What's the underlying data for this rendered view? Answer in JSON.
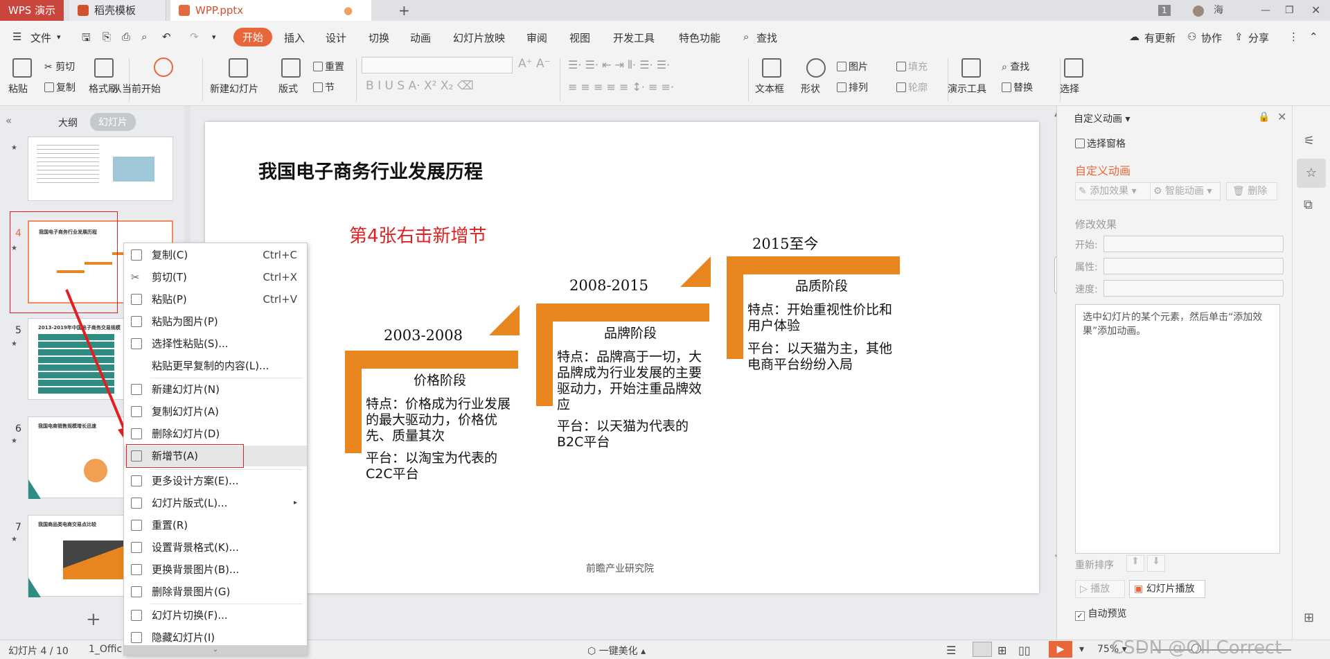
{
  "titlebar": {
    "app": "WPS 演示",
    "tab1": "稻壳模板",
    "tab2": "WPP.pptx",
    "new_tab": "+",
    "badge": "1",
    "user": "海"
  },
  "menu": {
    "file": "文件",
    "items": [
      "开始",
      "插入",
      "设计",
      "切换",
      "动画",
      "幻灯片放映",
      "审阅",
      "视图",
      "开发工具",
      "特色功能"
    ],
    "search": "查找",
    "update": "有更新",
    "collab": "协作",
    "share": "分享"
  },
  "ribbon": {
    "paste": "粘贴",
    "cut": "剪切",
    "copy": "复制",
    "format_painter": "格式刷",
    "from_current": "从当前开始",
    "new_slide": "新建幻灯片",
    "layout": "版式",
    "reset": "重置",
    "section": "节",
    "textbox": "文本框",
    "shape": "形状",
    "picture": "图片",
    "fill": "填充",
    "arrange": "排列",
    "outline": "轮廓",
    "present_tools": "演示工具",
    "find": "查找",
    "replace": "替换",
    "select": "选择"
  },
  "leftpanel": {
    "tab_outline": "大纲",
    "tab_slides": "幻灯片",
    "slide_numbers": [
      "4",
      "5",
      "6",
      "7"
    ],
    "add": "+",
    "thumb_titles": [
      "我国电子商务行业发展历程",
      "2013-2019年中国电子商务交易规模",
      "我国电商销售规模增长迅速",
      "我国商品类电商交易点比较"
    ]
  },
  "slide": {
    "title": "我国电子商务行业发展历程",
    "annotation": "第4张右击新增节",
    "footer": "前瞻产业研究院",
    "stages": [
      {
        "year": "2003-2008",
        "name": "价格阶段",
        "feature": "特点：价格成为行业发展的最大驱动力，价格优先、质量其次",
        "platform": "平台：以淘宝为代表的C2C平台"
      },
      {
        "year": "2008-2015",
        "name": "品牌阶段",
        "feature": "特点：品牌高于一切，大品牌成为行业发展的主要驱动力，开始注重品牌效应",
        "platform": "平台：以天猫为代表的B2C平台"
      },
      {
        "year": "2015至今",
        "name": "品质阶段",
        "feature": "特点：开始重视性价比和用户体验",
        "platform": "平台：以天猫为主，其他电商平台纷纷入局"
      }
    ]
  },
  "contextmenu": [
    {
      "label": "复制(C)",
      "shortcut": "Ctrl+C"
    },
    {
      "label": "剪切(T)",
      "shortcut": "Ctrl+X"
    },
    {
      "label": "粘贴(P)",
      "shortcut": "Ctrl+V"
    },
    {
      "label": "粘贴为图片(P)",
      "shortcut": ""
    },
    {
      "label": "选择性粘贴(S)...",
      "shortcut": ""
    },
    {
      "label": "粘贴更早复制的内容(L)...",
      "shortcut": ""
    },
    {
      "label": "新建幻灯片(N)",
      "shortcut": ""
    },
    {
      "label": "复制幻灯片(A)",
      "shortcut": ""
    },
    {
      "label": "删除幻灯片(D)",
      "shortcut": ""
    },
    {
      "label": "新增节(A)",
      "shortcut": ""
    },
    {
      "label": "更多设计方案(E)...",
      "shortcut": ""
    },
    {
      "label": "幻灯片版式(L)...",
      "shortcut": ""
    },
    {
      "label": "重置(R)",
      "shortcut": ""
    },
    {
      "label": "设置背景格式(K)...",
      "shortcut": ""
    },
    {
      "label": "更换背景图片(B)...",
      "shortcut": ""
    },
    {
      "label": "删除背景图片(G)",
      "shortcut": ""
    },
    {
      "label": "幻灯片切换(F)...",
      "shortcut": ""
    },
    {
      "label": "隐藏幻灯片(I)",
      "shortcut": ""
    }
  ],
  "rightpanel": {
    "header": "自定义动画",
    "select_pane": "选择窗格",
    "section_title": "自定义动画",
    "add_effect": "添加效果",
    "smart_anim": "智能动画",
    "delete": "删除",
    "modify": "修改效果",
    "start": "开始:",
    "property": "属性:",
    "speed": "速度:",
    "hint": "选中幻灯片的某个元素，然后单击“添加效果”添加动画。",
    "reorder": "重新排序",
    "play": "播放",
    "slideshow": "幻灯片播放",
    "autopreview": "自动预览"
  },
  "statusbar": {
    "slide_info": "幻灯片 4 / 10",
    "theme": "1_Offic",
    "beautify": "一键美化",
    "zoom": "75%",
    "watermark": "CSDN @Oll Correct"
  },
  "colors": {
    "accent": "#e8851f",
    "red": "#e02020",
    "wps": "#c9463d"
  }
}
